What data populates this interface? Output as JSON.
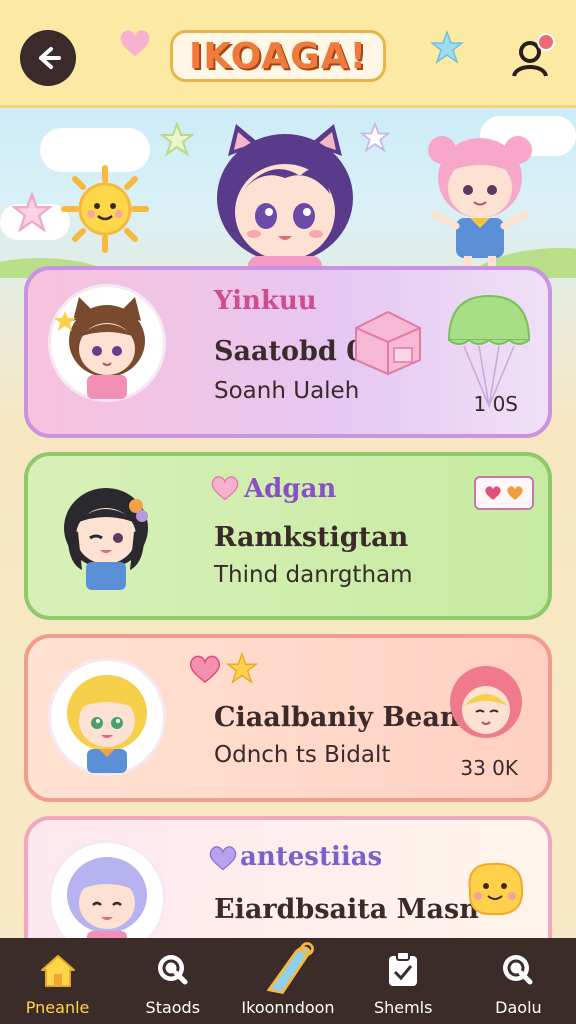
{
  "header": {
    "title": "IKOAGA!",
    "back_icon": "arrow-left-icon",
    "profile_icon": "profile-settings-icon"
  },
  "cards": [
    {
      "label": "Yinkuu",
      "title": "Saatobd 0",
      "subtitle": "Soanh Ualeh",
      "count": "1 0S",
      "color": "#c893e0"
    },
    {
      "label": "Adgan",
      "title": "Ramkstigtan",
      "subtitle": "Thind danrgtham",
      "count": "",
      "color": "#8fc96a"
    },
    {
      "label": "",
      "title": "Ciaalbaniy Bean",
      "subtitle": "Odnch ts Bidalt",
      "count": "33 0K",
      "color": "#ef9d8f"
    },
    {
      "label": "antestiias",
      "title": "Eiardbsaita Masn",
      "subtitle": "",
      "count": "",
      "color": "#f0a8bf"
    }
  ],
  "nav": [
    {
      "label": "Pneanle",
      "icon": "home-icon",
      "active": true
    },
    {
      "label": "Staods",
      "icon": "search-icon",
      "active": false
    },
    {
      "label": "Ikoonndoon",
      "icon": "create-icon",
      "active": false
    },
    {
      "label": "Shemls",
      "icon": "clipboard-icon",
      "active": false
    },
    {
      "label": "Daolu",
      "icon": "magnifier-icon",
      "active": false
    }
  ],
  "colors": {
    "header_bg": "#fbe9a4",
    "nav_bg": "#3b2c2a",
    "nav_active": "#ffd64a",
    "title": "#f07a3b"
  }
}
